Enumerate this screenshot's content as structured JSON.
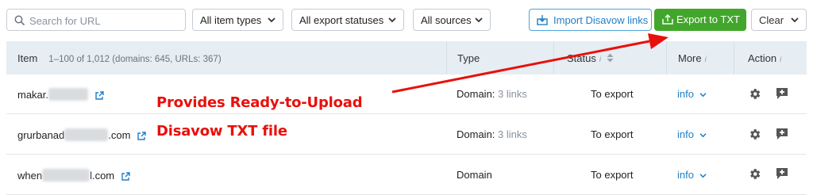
{
  "toolbar": {
    "search_placeholder": "Search for URL",
    "filters": [
      {
        "label": "All item types"
      },
      {
        "label": "All export statuses"
      },
      {
        "label": "All sources"
      }
    ],
    "import_label": "Import Disavow links",
    "export_label": "Export to TXT",
    "clear_label": "Clear"
  },
  "table": {
    "headers": {
      "item": "Item",
      "item_range": "1–100 of 1,012 (domains: 645, URLs: 367)",
      "type": "Type",
      "status": "Status",
      "more": "More",
      "action": "Action",
      "info_mark": "i"
    },
    "rows": [
      {
        "item_prefix": "makar.",
        "item_suffix": "",
        "type_main": "Domain:",
        "type_links": "3 links",
        "status": "To export",
        "more": "info"
      },
      {
        "item_prefix": "grurbanad",
        "item_suffix": ".com",
        "type_main": "Domain:",
        "type_links": "3 links",
        "status": "To export",
        "more": "info"
      },
      {
        "item_prefix": "when",
        "item_suffix": "l.com",
        "type_main": "Domain",
        "type_links": "",
        "status": "To export",
        "more": "info"
      }
    ]
  },
  "annotation": {
    "line1": "Provides Ready-to-Upload",
    "line2": "Disavow TXT file",
    "color": "#e8100b"
  },
  "colors": {
    "accent_green": "#43a62c",
    "link_blue": "#1f7fc8",
    "header_bg": "#e6edf3"
  },
  "icons": [
    "search-icon",
    "chevron-down-icon",
    "import-icon",
    "export-icon",
    "external-link-icon",
    "gear-icon",
    "comment-add-icon",
    "sort-icon"
  ]
}
